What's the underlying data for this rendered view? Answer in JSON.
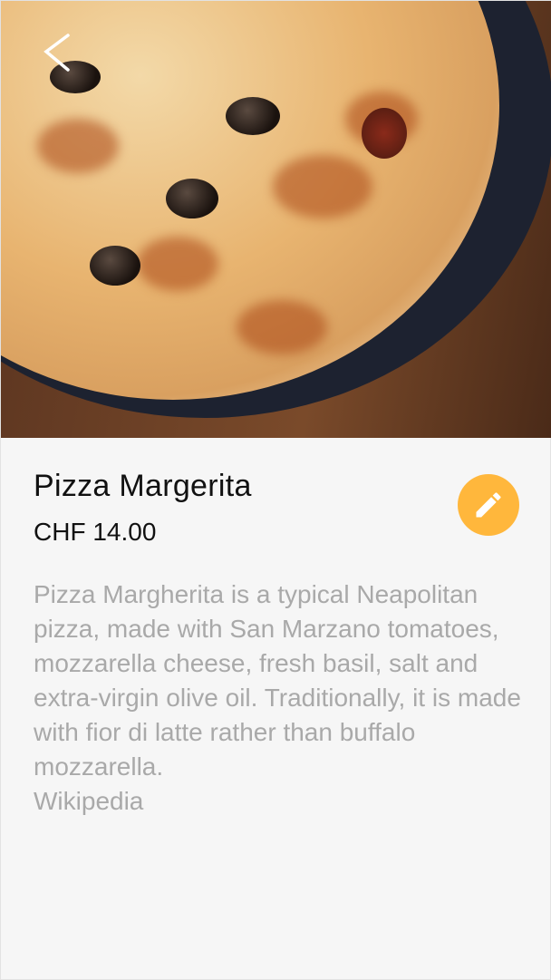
{
  "hero": {
    "image": "pizza-photo",
    "back_icon": "chevron-left-icon"
  },
  "product": {
    "title": "Pizza Margerita",
    "price": "CHF 14.00",
    "description": "Pizza Margherita is a typical Neapolitan pizza, made with San Marzano tomatoes, mozzarella cheese, fresh basil, salt and extra-virgin olive oil. Traditionally, it is made with fior di latte rather than buffalo mozzarella.",
    "source": "Wikipedia"
  },
  "colors": {
    "accent": "#ffb73c",
    "background": "#f6f6f6",
    "description": "#a9a9a9"
  }
}
